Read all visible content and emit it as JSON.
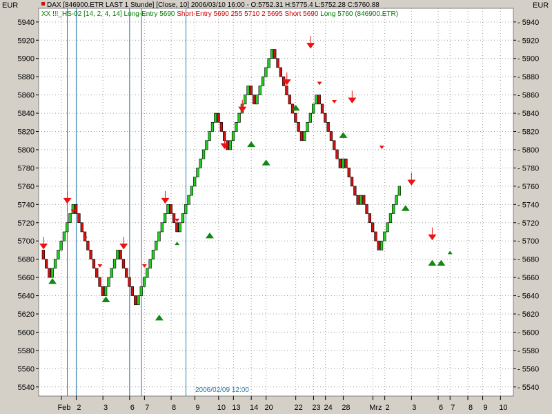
{
  "corner_left": "EUR",
  "corner_right": "EUR",
  "header": {
    "line1": "DAX [846900.ETR LAST 1 Stunde] [Close, 10] 2006/03/10 16:00 - O:5752.31 H:5775.4 L:5752.28 C:5760.88",
    "line2_segments": [
      {
        "text": "XX !!!_HS-02 [14, 2, 4, 14] Long-Entry 5690 ",
        "color": "#007a00"
      },
      {
        "text": "Short-Entry 5690 255 5710 2 5695 Short 5690 ",
        "color": "#cc0000"
      },
      {
        "text": "Long 5760 (846900.ETR)",
        "color": "#007a00"
      }
    ]
  },
  "cursor_label": "2006/02/09 12:00",
  "colors": {
    "up": "#22cc22",
    "down": "#cc1111",
    "buy": "#118811",
    "sell": "#ee1111",
    "vline": "#2277aa"
  },
  "chart_data": {
    "type": "renko",
    "title": "DAX [846900.ETR LAST 1 Stunde] [Close, 10]",
    "ylim": [
      5530,
      5955
    ],
    "yticks": [
      5540,
      5560,
      5580,
      5600,
      5620,
      5640,
      5660,
      5680,
      5700,
      5720,
      5740,
      5760,
      5780,
      5800,
      5820,
      5840,
      5860,
      5880,
      5900,
      5920,
      5940
    ],
    "grid": true,
    "box_size": 10,
    "bricks": [
      5680,
      5670,
      5660,
      5670,
      5680,
      5690,
      5700,
      5710,
      5720,
      5730,
      5740,
      5730,
      5720,
      5710,
      5700,
      5690,
      5680,
      5670,
      5660,
      5650,
      5640,
      5650,
      5660,
      5670,
      5680,
      5690,
      5680,
      5670,
      5660,
      5650,
      5640,
      5630,
      5640,
      5650,
      5660,
      5670,
      5680,
      5690,
      5700,
      5710,
      5720,
      5730,
      5740,
      5730,
      5720,
      5710,
      5720,
      5730,
      5740,
      5750,
      5760,
      5770,
      5780,
      5790,
      5800,
      5810,
      5820,
      5830,
      5840,
      5830,
      5820,
      5810,
      5800,
      5810,
      5820,
      5830,
      5840,
      5850,
      5860,
      5870,
      5860,
      5850,
      5860,
      5870,
      5880,
      5890,
      5900,
      5910,
      5900,
      5890,
      5880,
      5870,
      5860,
      5850,
      5840,
      5830,
      5820,
      5810,
      5820,
      5830,
      5840,
      5850,
      5860,
      5850,
      5840,
      5830,
      5820,
      5810,
      5800,
      5790,
      5780,
      5790,
      5780,
      5770,
      5760,
      5750,
      5740,
      5750,
      5740,
      5730,
      5720,
      5710,
      5700,
      5690,
      5700,
      5710,
      5720,
      5730,
      5740,
      5750,
      5760
    ],
    "x_ticks": [
      {
        "label": "Feb",
        "i": 6
      },
      {
        "label": "2",
        "i": 11
      },
      {
        "label": "3",
        "i": 20
      },
      {
        "label": "6",
        "i": 29
      },
      {
        "label": "7",
        "i": 34
      },
      {
        "label": "8",
        "i": 43
      },
      {
        "label": "9",
        "i": 51
      },
      {
        "label": "10",
        "i": 59
      },
      {
        "label": "13",
        "i": 64
      },
      {
        "label": "14",
        "i": 70
      },
      {
        "label": "20",
        "i": 75
      },
      {
        "label": "22",
        "i": 85
      },
      {
        "label": "23",
        "i": 91
      },
      {
        "label": "24",
        "i": 95
      },
      {
        "label": "28",
        "i": 101
      },
      {
        "label": "Mrz",
        "i": 111
      },
      {
        "label": "2",
        "i": 115
      },
      {
        "label": "3",
        "i": 124
      },
      {
        "label": "6",
        "i": 133
      },
      {
        "label": "7",
        "i": 137
      },
      {
        "label": "8",
        "i": 143
      },
      {
        "label": "9",
        "i": 148
      },
      {
        "label": "10",
        "i": 154
      }
    ],
    "vlines": [
      8,
      11,
      29,
      33,
      48
    ],
    "buy_signals": [
      {
        "i": 3,
        "price": 5670,
        "size": "big"
      },
      {
        "i": 21,
        "price": 5650,
        "size": "big"
      },
      {
        "i": 39,
        "price": 5630,
        "size": "big"
      },
      {
        "i": 45,
        "price": 5710,
        "size": "small"
      },
      {
        "i": 56,
        "price": 5720,
        "size": "big"
      },
      {
        "i": 70,
        "price": 5820,
        "size": "big"
      },
      {
        "i": 75,
        "price": 5800,
        "size": "big"
      },
      {
        "i": 85,
        "price": 5860,
        "size": "big"
      },
      {
        "i": 101,
        "price": 5830,
        "size": "big"
      },
      {
        "i": 122,
        "price": 5750,
        "size": "big"
      },
      {
        "i": 131,
        "price": 5690,
        "size": "big"
      },
      {
        "i": 134,
        "price": 5690,
        "size": "big"
      },
      {
        "i": 137,
        "price": 5700,
        "size": "small"
      }
    ],
    "sell_signals": [
      {
        "i": 0,
        "price": 5690,
        "size": "big"
      },
      {
        "i": 8,
        "price": 5740,
        "size": "big"
      },
      {
        "i": 10,
        "price": 5730,
        "size": "small"
      },
      {
        "i": 14,
        "price": 5700,
        "size": "small"
      },
      {
        "i": 19,
        "price": 5670,
        "size": "small"
      },
      {
        "i": 27,
        "price": 5690,
        "size": "big"
      },
      {
        "i": 34,
        "price": 5670,
        "size": "small"
      },
      {
        "i": 41,
        "price": 5740,
        "size": "big"
      },
      {
        "i": 45,
        "price": 5720,
        "size": "small"
      },
      {
        "i": 61,
        "price": 5800,
        "size": "big"
      },
      {
        "i": 67,
        "price": 5840,
        "size": "big"
      },
      {
        "i": 82,
        "price": 5870,
        "size": "big"
      },
      {
        "i": 90,
        "price": 5910,
        "size": "big"
      },
      {
        "i": 93,
        "price": 5870,
        "size": "small"
      },
      {
        "i": 98,
        "price": 5850,
        "size": "small"
      },
      {
        "i": 104,
        "price": 5850,
        "size": "big"
      },
      {
        "i": 114,
        "price": 5800,
        "size": "small"
      },
      {
        "i": 124,
        "price": 5760,
        "size": "big"
      },
      {
        "i": 131,
        "price": 5700,
        "size": "big"
      }
    ]
  }
}
